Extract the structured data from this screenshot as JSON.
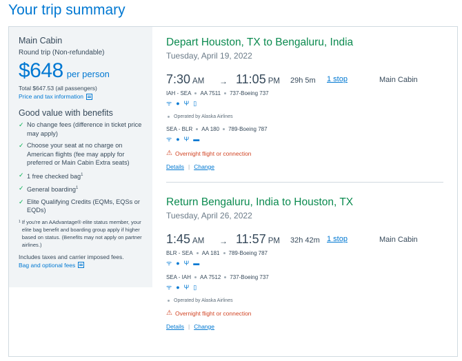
{
  "page_title": "Your trip summary",
  "sidebar": {
    "cabin": "Main Cabin",
    "trip_type": "Round trip (Non-refundable)",
    "price": "$648",
    "per_person": "per person",
    "total": "Total $647.53 (all passengers)",
    "price_tax_link": "Price and tax information",
    "benefits_title": "Good value with benefits",
    "benefits": [
      "No change fees (difference in ticket price may apply)",
      "Choose your seat at no charge on American flights (fee may apply for preferred or Main Cabin Extra seats)",
      "1 free checked bag",
      "General boarding",
      "Elite Qualifying Credits (EQMs, EQSs or EQDs)"
    ],
    "footnote_mark": "1",
    "footnote": "If you're an AAdvantage® elite status member, your elite bag benefit and boarding group apply if higher based on status. (Benefits may not apply on partner airlines.)",
    "includes": "Includes taxes and carrier imposed fees.",
    "bag_link": "Bag and optional fees"
  },
  "slices": [
    {
      "title": "Depart Houston, TX to Bengaluru, India",
      "date": "Tuesday, April 19, 2022",
      "dep_time": "7:30",
      "dep_ampm": "AM",
      "arrow": "→",
      "arr_time": "11:05",
      "arr_ampm": "PM",
      "duration": "29h 5m",
      "stops": "1 stop",
      "cabin": "Main Cabin",
      "segments": [
        {
          "route": "IAH - SEA",
          "flight": "AA 7511",
          "aircraft": "737-Boeing 737",
          "operated": "Operated by Alaska Airlines"
        },
        {
          "route": "SEA - BLR",
          "flight": "AA 180",
          "aircraft": "789-Boeing 787",
          "operated": ""
        }
      ],
      "overnight": "Overnight flight or connection",
      "details": "Details",
      "change": "Change"
    },
    {
      "title": "Return Bengaluru, India to Houston, TX",
      "date": "Tuesday, April 26, 2022",
      "dep_time": "1:45",
      "dep_ampm": "AM",
      "arrow": "→",
      "arr_time": "11:57",
      "arr_ampm": "PM",
      "duration": "32h 42m",
      "stops": "1 stop",
      "cabin": "Main Cabin",
      "segments": [
        {
          "route": "BLR - SEA",
          "flight": "AA 181",
          "aircraft": "789-Boeing 787",
          "operated": ""
        },
        {
          "route": "SEA - IAH",
          "flight": "AA 7512",
          "aircraft": "737-Boeing 737",
          "operated": "Operated by Alaska Airlines"
        }
      ],
      "overnight": "Overnight flight or connection",
      "details": "Details",
      "change": "Change"
    }
  ],
  "amenity_icons": [
    "wifi-icon",
    "power-icon",
    "usb-icon",
    "entertainment-icon"
  ],
  "colors": {
    "brand_blue": "#0078d2",
    "green_title": "#0b8a4f",
    "warning": "#d14424"
  }
}
